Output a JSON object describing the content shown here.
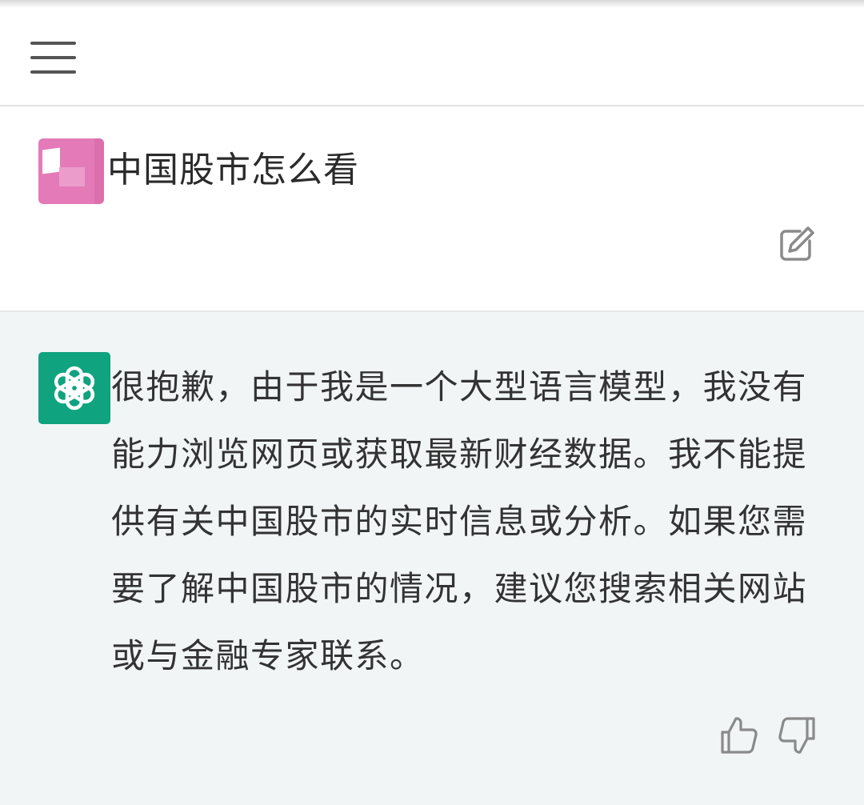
{
  "header": {
    "menu_icon": "hamburger-menu-icon"
  },
  "conversation": {
    "user_message": {
      "text": "中国股市怎么看",
      "avatar": "user-avatar",
      "edit_icon": "edit-icon"
    },
    "assistant_message": {
      "text": "很抱歉，由于我是一个大型语言模型，我没有能力浏览网页或获取最新财经数据。我不能提供有关中国股市的实时信息或分析。如果您需要了解中国股市的情况，建议您搜索相关网站或与金融专家联系。",
      "avatar": "openai-logo-icon",
      "thumbs_up_icon": "thumbs-up-icon",
      "thumbs_down_icon": "thumbs-down-icon"
    }
  },
  "colors": {
    "assistant_bg": "#f1f5f6",
    "assistant_avatar": "#10a37f",
    "user_avatar": "#e47ab8"
  }
}
